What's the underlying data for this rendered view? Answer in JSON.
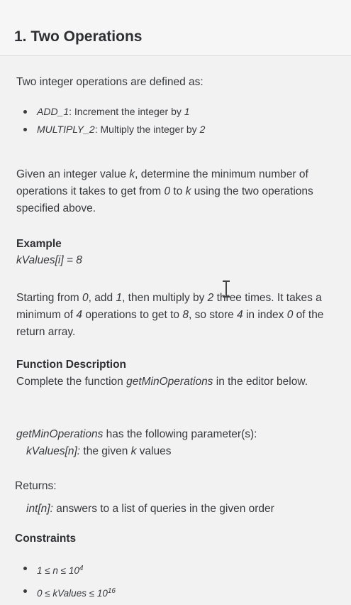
{
  "title": "1. Two Operations",
  "intro": "Two integer operations are defined as:",
  "operations": [
    {
      "name": "ADD_1",
      "desc": ": Increment the integer by ",
      "arg": "1"
    },
    {
      "name": "MULTIPLY_2",
      "desc": ": Multiply the integer by ",
      "arg": "2"
    }
  ],
  "task": {
    "part1": "Given an integer value ",
    "k": "k",
    "part2": ", determine the minimum number of operations it takes to get from ",
    "zero": "0",
    "part3": " to ",
    "k2": "k",
    "part4": " using the two operations specified above."
  },
  "example": {
    "heading": "Example",
    "input": "kValues[i] = 8",
    "exp": {
      "a": "Starting from ",
      "zero": "0",
      "b": ", add ",
      "one": "1",
      "c": ", then multiply by ",
      "two": "2",
      "d": " three times. It takes a minimum of ",
      "four": "4",
      "e": " operations to get to ",
      "eight": "8",
      "f": ", so store ",
      "four2": "4",
      "g": " in index ",
      "zero2": "0",
      "h": " of the return array."
    }
  },
  "function_description": {
    "heading": "Function Description",
    "a": "Complete the function ",
    "fn": "getMinOperations",
    "b": " in the editor below."
  },
  "params": {
    "fn": "getMinOperations",
    "text": " has the following parameter(s):",
    "param_name": "kValues[n]:",
    "param_text": " the given ",
    "param_k": "k",
    "param_end": " values"
  },
  "returns": {
    "label": "Returns:",
    "type": "int[n]:",
    "text": " answers to a list of queries in the given order"
  },
  "constraints": {
    "heading": "Constraints",
    "c1_main": "1 ≤ n ≤ 10",
    "c1_exp": "4",
    "c2_main": "0 ≤ kValues ≤ 10",
    "c2_exp": "16"
  }
}
